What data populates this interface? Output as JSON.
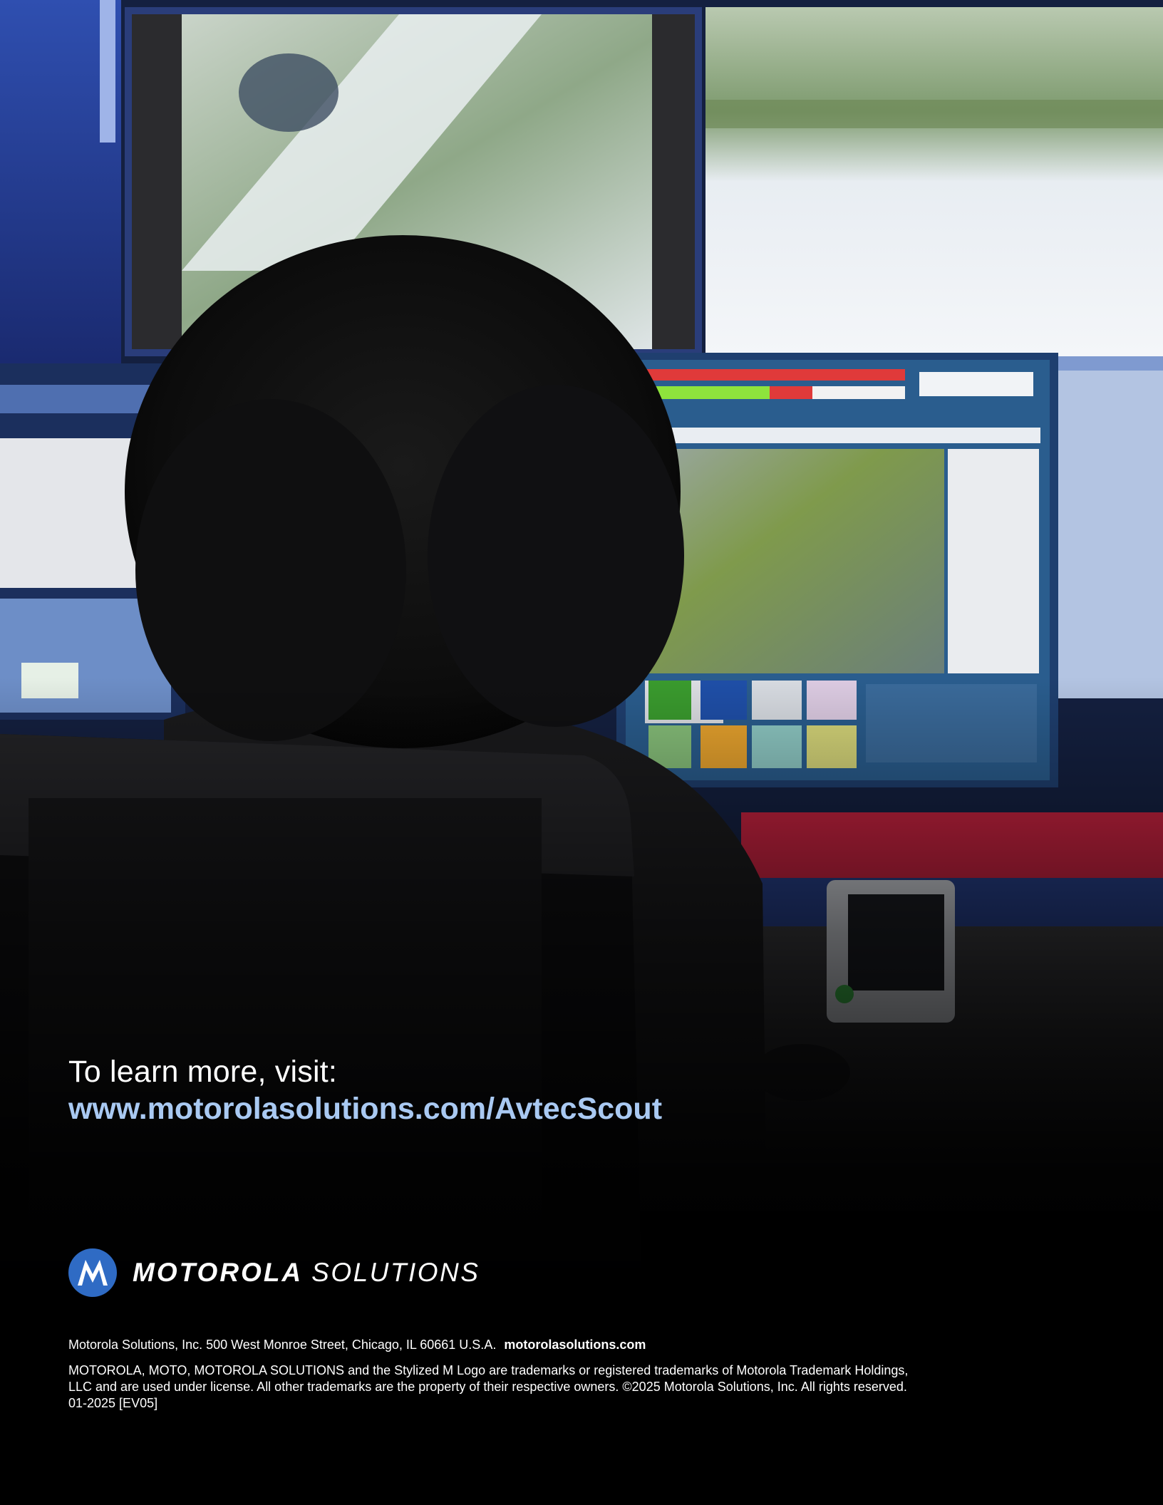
{
  "cta": {
    "lead": "To learn more, visit:",
    "url": "www.motorolasolutions.com/AvtecScout"
  },
  "brand": {
    "name_bold": "MOTOROLA",
    "name_light": "SOLUTIONS",
    "logo_icon": "motorola-m-logo-icon",
    "logo_color": "#2f6bc4"
  },
  "footer": {
    "address": "Motorola Solutions, Inc. 500 West Monroe Street, Chicago, IL 60661 U.S.A.",
    "website": "motorolasolutions.com",
    "legal": "MOTOROLA, MOTO, MOTOROLA SOLUTIONS and the Stylized M Logo are trademarks or registered trademarks of Motorola Trademark Holdings, LLC and are used under license. All other trademarks are the property of their respective owners. ©2025 Motorola Solutions, Inc. All rights reserved. 01-2025 [EV05]"
  },
  "colors": {
    "background": "#000000",
    "link": "#a9c9f2",
    "text": "#ffffff"
  }
}
